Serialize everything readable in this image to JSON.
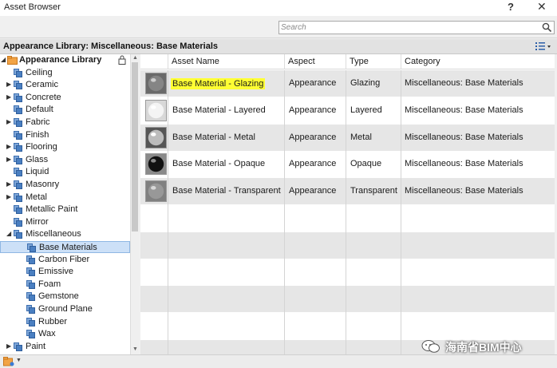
{
  "window": {
    "title": "Asset Browser",
    "help_label": "?",
    "close_label": "✕"
  },
  "search": {
    "placeholder": "Search",
    "value": ""
  },
  "library_bar": {
    "label": "Appearance Library: Miscellaneous: Base Materials"
  },
  "tree": {
    "root": "Appearance Library",
    "items": [
      {
        "label": "Ceiling",
        "expandable": false
      },
      {
        "label": "Ceramic",
        "expandable": true
      },
      {
        "label": "Concrete",
        "expandable": true
      },
      {
        "label": "Default",
        "expandable": false
      },
      {
        "label": "Fabric",
        "expandable": true
      },
      {
        "label": "Finish",
        "expandable": false
      },
      {
        "label": "Flooring",
        "expandable": true
      },
      {
        "label": "Glass",
        "expandable": true
      },
      {
        "label": "Liquid",
        "expandable": false
      },
      {
        "label": "Masonry",
        "expandable": true
      },
      {
        "label": "Metal",
        "expandable": true
      },
      {
        "label": "Metallic Paint",
        "expandable": false
      },
      {
        "label": "Mirror",
        "expandable": false
      },
      {
        "label": "Miscellaneous",
        "expandable": true,
        "expanded": true
      },
      {
        "label": "Base Materials",
        "child": true,
        "selected": true
      },
      {
        "label": "Carbon Fiber",
        "child": true
      },
      {
        "label": "Emissive",
        "child": true
      },
      {
        "label": "Foam",
        "child": true
      },
      {
        "label": "Gemstone",
        "child": true
      },
      {
        "label": "Ground Plane",
        "child": true
      },
      {
        "label": "Rubber",
        "child": true
      },
      {
        "label": "Wax",
        "child": true
      },
      {
        "label": "Paint",
        "expandable": true
      }
    ]
  },
  "grid": {
    "columns": [
      "Asset Name",
      "Aspect",
      "Type",
      "Category"
    ],
    "rows": [
      {
        "name": "Base Material - Glazing",
        "aspect": "Appearance",
        "type": "Glazing",
        "category": "Miscellaneous: Base Materials",
        "highlighted": true,
        "thumb": "glazing"
      },
      {
        "name": "Base Material - Layered",
        "aspect": "Appearance",
        "type": "Layered",
        "category": "Miscellaneous: Base Materials",
        "thumb": "layered"
      },
      {
        "name": "Base Material - Metal",
        "aspect": "Appearance",
        "type": "Metal",
        "category": "Miscellaneous: Base Materials",
        "thumb": "metal"
      },
      {
        "name": "Base Material - Opaque",
        "aspect": "Appearance",
        "type": "Opaque",
        "category": "Miscellaneous: Base Materials",
        "thumb": "opaque"
      },
      {
        "name": "Base Material - Transparent",
        "aspect": "Appearance",
        "type": "Transparent",
        "category": "Miscellaneous: Base Materials",
        "thumb": "transparent"
      }
    ]
  },
  "watermark": {
    "text": "海南省BIM中心"
  },
  "colors": {
    "selection": "#cce0f7",
    "highlight": "#ffff33",
    "row_alt": "#e6e6e6",
    "folder_blue": "#4a7fc1",
    "root_folder": "#f0a040"
  }
}
